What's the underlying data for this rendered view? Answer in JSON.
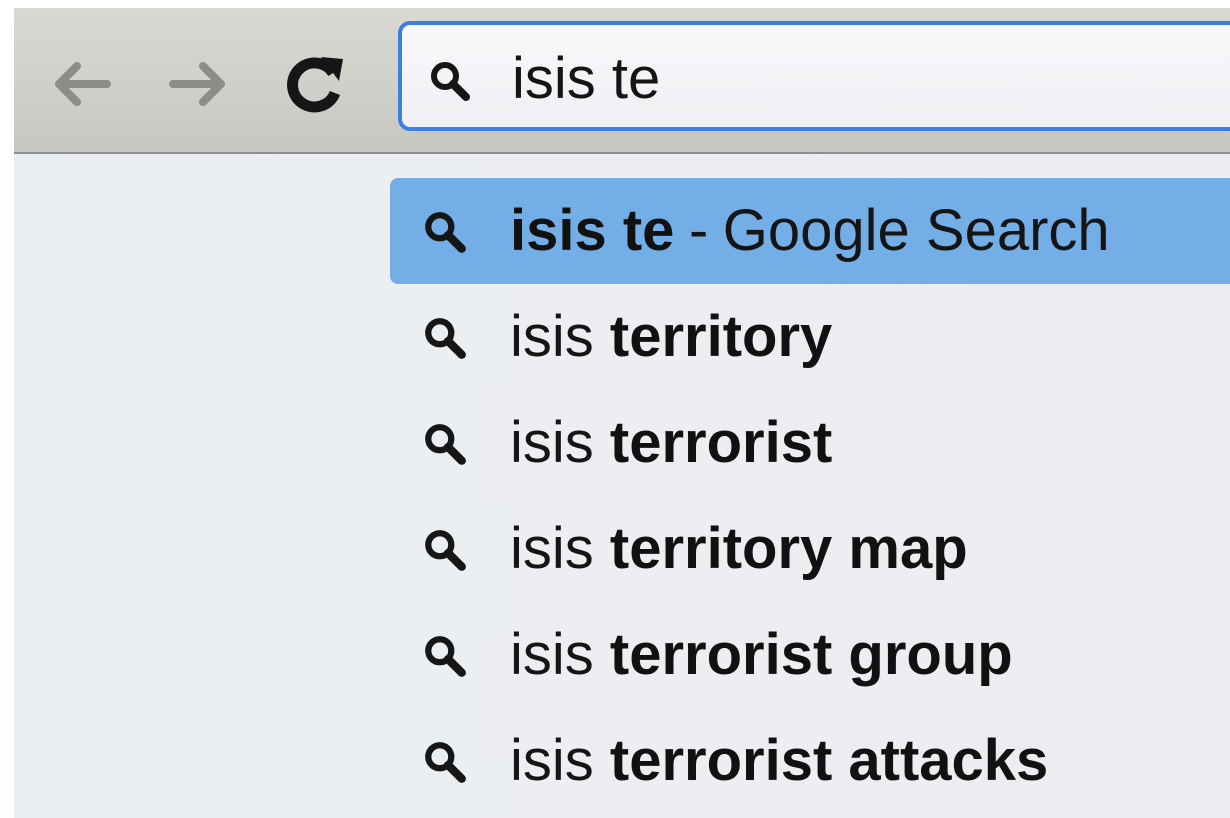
{
  "toolbar": {
    "back_icon": "arrow-left-icon",
    "forward_icon": "arrow-right-icon",
    "reload_icon": "reload-icon"
  },
  "omnibox": {
    "icon": "search-icon",
    "value": "isis te",
    "accent_color": "#3d7fe0"
  },
  "suggestions": [
    {
      "prefix": "isis te",
      "suffix": "",
      "separator": "-",
      "provider": "Google Search",
      "selected": true
    },
    {
      "prefix": "isis ",
      "suffix": "territory"
    },
    {
      "prefix": "isis ",
      "suffix": "terrorist"
    },
    {
      "prefix": "isis ",
      "suffix": "territory map"
    },
    {
      "prefix": "isis ",
      "suffix": "terrorist group"
    },
    {
      "prefix": "isis ",
      "suffix": "terrorist attacks"
    }
  ],
  "colors": {
    "selected_row": "#74aee7",
    "toolbar": "#cfcfca"
  }
}
